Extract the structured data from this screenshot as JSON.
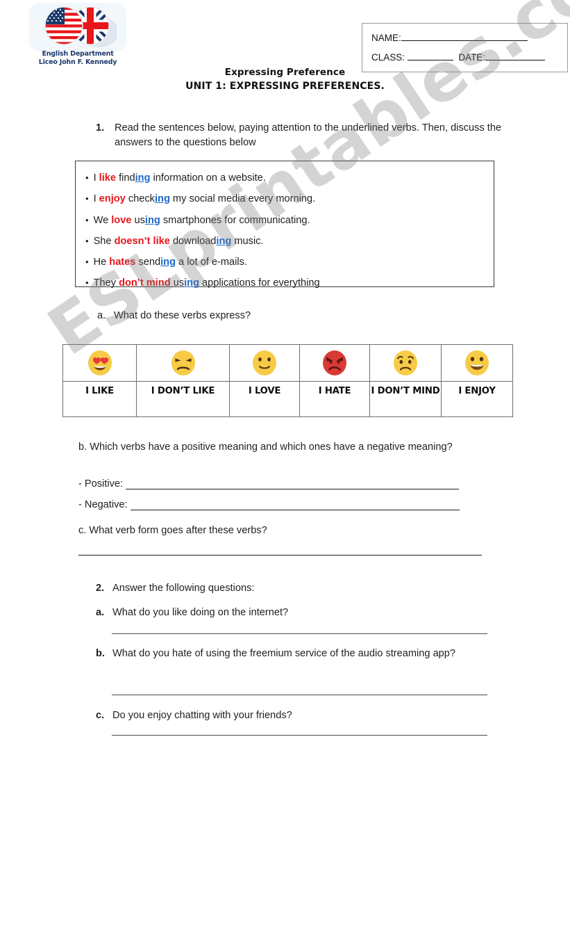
{
  "document": {
    "logo": {
      "line1": "English Department",
      "line2": "Liceo John F. Kennedy",
      "flag_left": "us-flag-icon",
      "flag_right": "uk-flag-icon"
    },
    "watermark": "ESLprintables.com",
    "header_fields": {
      "name_label": "NAME:",
      "class_label": "CLASS:",
      "date_label": "DATE:"
    },
    "title": "Expressing Preference",
    "subtitle": "UNIT 1: EXPRESSING PREFERENCES."
  },
  "exercise1": {
    "number": "1.",
    "instruction": "Read the sentences below, paying attention to the underlined verbs. Then, discuss the answers to the questions below",
    "sentences": [
      {
        "pre": "I ",
        "verb": "like",
        "mid": " find",
        "ing": "ing",
        "post": " information on a website."
      },
      {
        "pre": "I ",
        "verb": "enjoy",
        "mid": " check",
        "ing": "ing",
        "post": " my social media every morning."
      },
      {
        "pre": "We ",
        "verb": "love",
        "mid": " us",
        "ing": "ing",
        "post": " smartphones for communicating."
      },
      {
        "pre": "She ",
        "verb": "doesn’t like",
        "mid": " download",
        "ing": "ing",
        "post": " music."
      },
      {
        "pre": "He ",
        "verb": "hates",
        "mid": " send",
        "ing": "ing",
        "post": " a lot of e-mails."
      },
      {
        "pre": "They ",
        "verb": "don’t mind",
        "mid": " us",
        "ing": "ing",
        "post": " applications for everything"
      }
    ],
    "sub_a": {
      "label": "a.",
      "text": "What do these verbs express?"
    },
    "emoji_table": {
      "cells": [
        {
          "label": "I LIKE",
          "icon": "heart-eyes-face-icon"
        },
        {
          "label": "I DON’T LIKE",
          "icon": "unamused-face-icon"
        },
        {
          "label": "I LOVE",
          "icon": "slightly-smiling-face-icon"
        },
        {
          "label": "I HATE",
          "icon": "angry-face-icon"
        },
        {
          "label": "I DON’T MIND",
          "icon": "worried-face-icon"
        },
        {
          "label": "I ENJOY",
          "icon": "grinning-face-icon"
        }
      ]
    },
    "sub_b": {
      "label": "b.",
      "text": "b. Which verbs have a positive meaning and which ones have a negative meaning?",
      "positive_label": "- Positive:",
      "negative_label": "- Negative:"
    },
    "sub_c": {
      "label": "c.",
      "text": "c. What verb form goes after these verbs?"
    }
  },
  "exercise2": {
    "number": "2.",
    "instruction": "Answer the following questions:",
    "questions": [
      {
        "label": "a.",
        "text": "What do you like doing on the internet?"
      },
      {
        "label": "b.",
        "text": "What do you hate of using the freemium service of the audio streaming app?"
      },
      {
        "label": "c.",
        "text": "Do you enjoy chatting with your friends?"
      }
    ]
  },
  "colors": {
    "verb_red": "#e8161a",
    "ing_blue": "#1b69c9",
    "emoji_yellow": "#f7cb46",
    "angry_red": "#d93a36",
    "watermark_gray": "#7d7d7d",
    "logo_navy": "#1b3a6b"
  }
}
